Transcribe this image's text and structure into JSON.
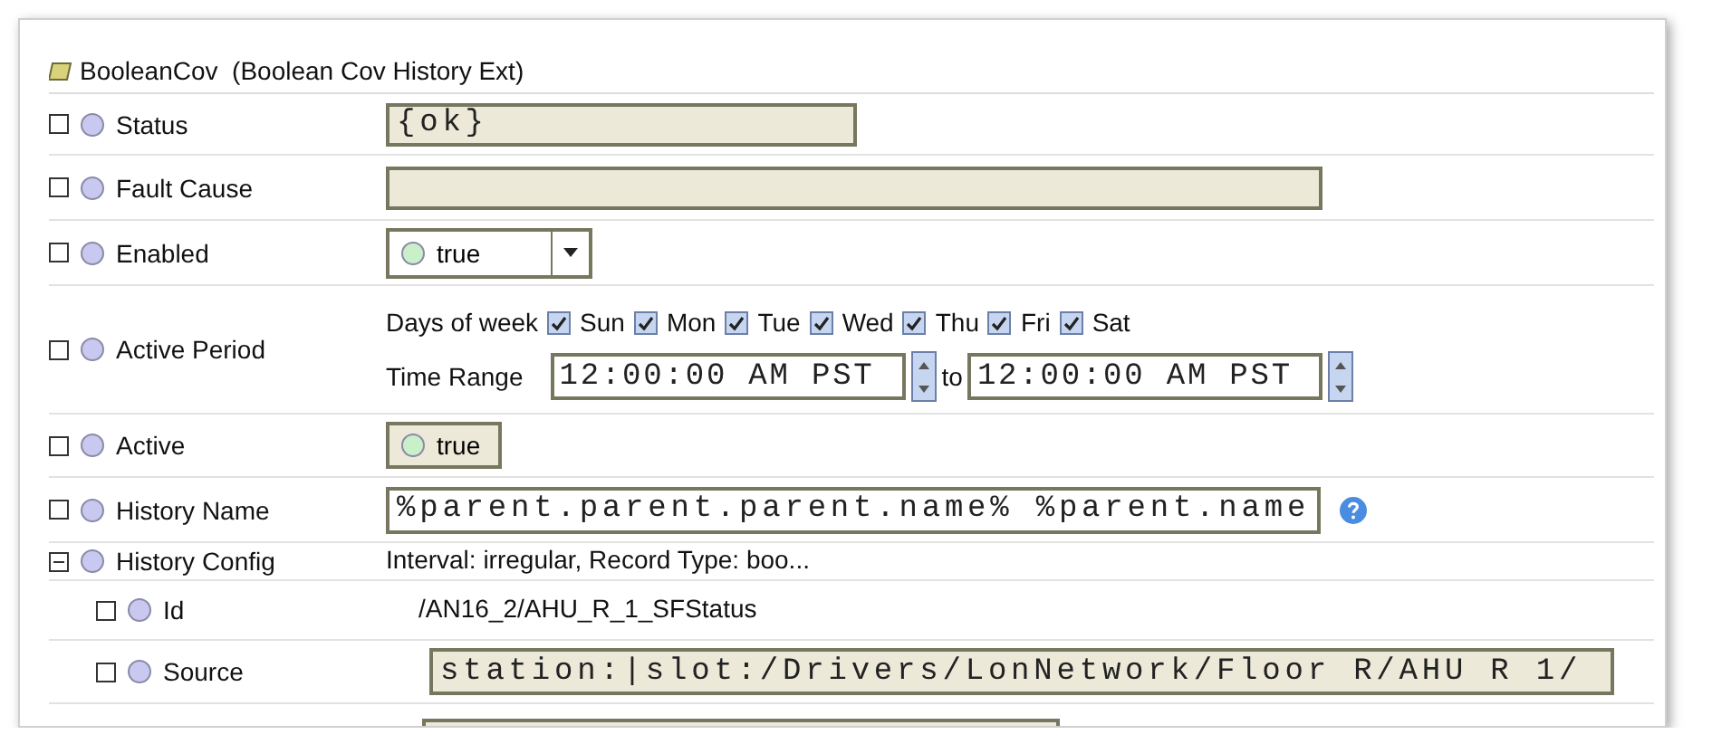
{
  "header": {
    "title": "BooleanCov  (Boolean Cov History Ext)"
  },
  "rows": [
    {
      "name": "Status",
      "kind": "readonly",
      "value": "{ok}"
    },
    {
      "name": "Fault Cause",
      "kind": "readonly-wide",
      "value": ""
    },
    {
      "name": "Enabled",
      "kind": "dropdown",
      "value": "true"
    },
    {
      "name": "Active Period",
      "kind": "period",
      "days_label": "Days of week",
      "days": [
        {
          "label": "Sun",
          "checked": true
        },
        {
          "label": "Mon",
          "checked": true
        },
        {
          "label": "Tue",
          "checked": true
        },
        {
          "label": "Wed",
          "checked": true
        },
        {
          "label": "Thu",
          "checked": true
        },
        {
          "label": "Fri",
          "checked": true
        },
        {
          "label": "Sat",
          "checked": true
        }
      ],
      "range_label": "Time Range",
      "from": "12:00:00 AM PST",
      "to_label": "to",
      "to": "12:00:00 AM PST"
    },
    {
      "name": "Active",
      "kind": "bool",
      "value": "true"
    },
    {
      "name": "History Name",
      "kind": "input",
      "value": "%parent.parent.parent.name% %parent.name"
    },
    {
      "name": "History Config",
      "kind": "text",
      "value": "Interval: irregular, Record Type: boo...",
      "expanded": true,
      "children": [
        {
          "name": "Id",
          "kind": "text",
          "value": "/AN16_2/AHU_R_1_SFStatus"
        },
        {
          "name": "Source",
          "kind": "source",
          "value": "station:|slot:/Drivers/LonNetwork/Floor R/AHU R 1/"
        },
        {
          "kind": "clipped"
        }
      ]
    }
  ]
}
